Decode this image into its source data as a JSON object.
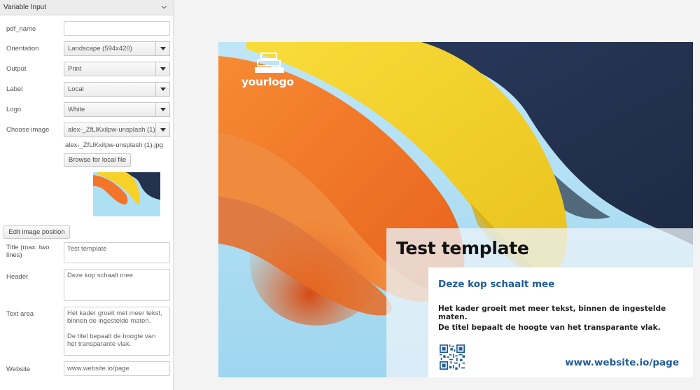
{
  "panel": {
    "title": "Variable Input",
    "fields": {
      "pdf_name": {
        "label": "pdf_name",
        "value": ""
      },
      "orientation": {
        "label": "Orientation",
        "value": "Landscape (594x420)"
      },
      "output": {
        "label": "Output",
        "value": "Print"
      },
      "label": {
        "label": "Label",
        "value": "Local"
      },
      "logo": {
        "label": "Logo",
        "value": "White"
      },
      "image": {
        "label": "Choose image",
        "value": "alex-_ZfLlKxilpw-unsplash (1).jpg",
        "filename": "alex-_ZfLlKxilpw-unsplash (1).jpg"
      },
      "browse_label": "Browse for local file",
      "edit_position_label": "Edit image position",
      "title": {
        "label": "Title (max. two lines)",
        "value": "Test template"
      },
      "header": {
        "label": "Header",
        "value": "Deze kop schaalt mee"
      },
      "text_area": {
        "label": "Text area",
        "value": "Het kader groeit met meer tekst, binnen de ingestelde maten.\n\nDe titel bepaalt de hoogte van het transparante vlak."
      },
      "website": {
        "label": "Website",
        "value": "www.website.io/page"
      }
    }
  },
  "preview": {
    "logo_text": "yourlogo",
    "title": "Test template",
    "header": "Deze kop schaalt mee",
    "paragraph1": "Het kader groeit met meer tekst, binnen de ingestelde maten.",
    "paragraph2": "De titel bepaalt de hoogte van het transparante vlak.",
    "website": "www.website.io/page"
  },
  "colors": {
    "accent_blue": "#1f5c9b",
    "paper_orange": "#f2752a",
    "paper_yellow": "#f7d126",
    "paper_navy": "#23324f",
    "background_sky": "#a9d9ef"
  },
  "icons": [
    "chevron-down-icon",
    "dropdown-arrow-icon",
    "logo-stack-icon",
    "qr-code-icon"
  ]
}
